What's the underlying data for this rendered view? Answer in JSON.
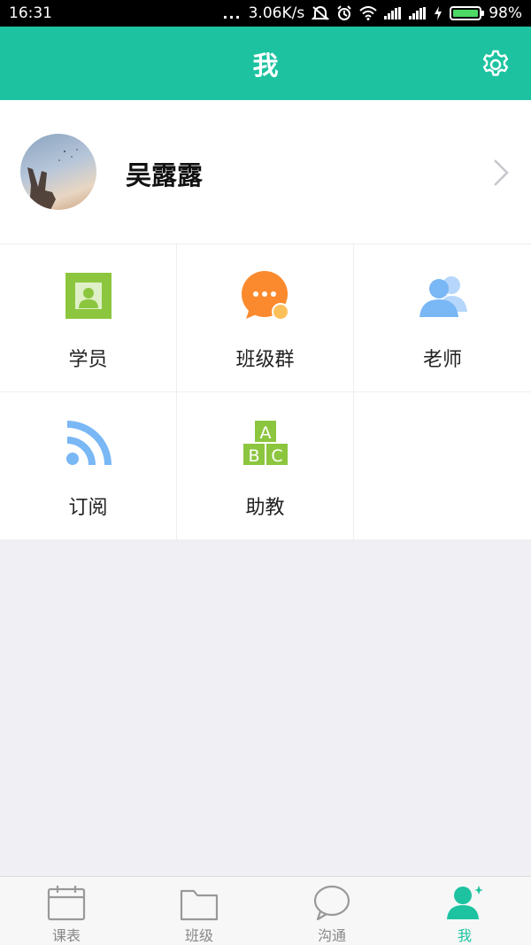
{
  "status_bar": {
    "time": "16:31",
    "dots": "...",
    "network_speed": "3.06K/s",
    "battery_percent": "98%",
    "icons": [
      "mute-icon",
      "alarm-icon",
      "wifi-icon",
      "signal-icon",
      "signal-icon",
      "charging-icon",
      "battery-icon"
    ]
  },
  "header": {
    "title": "我",
    "settings_icon": "gear-icon",
    "accent_color": "#1dc3a0"
  },
  "profile": {
    "name": "吴露露",
    "chevron_icon": "chevron-right-icon"
  },
  "grid": {
    "items": [
      {
        "label": "学员",
        "icon": "student-card-icon",
        "color": "#8cc63f"
      },
      {
        "label": "班级群",
        "icon": "chat-bubble-icon",
        "color": "#fb8a2e"
      },
      {
        "label": "老师",
        "icon": "teachers-icon",
        "color": "#79b7f5"
      },
      {
        "label": "订阅",
        "icon": "rss-icon",
        "color": "#79b7f5"
      },
      {
        "label": "助教",
        "icon": "abc-blocks-icon",
        "color": "#8cc63f"
      }
    ]
  },
  "tab_bar": {
    "active_color": "#1dc3a0",
    "tabs": [
      {
        "label": "课表",
        "icon": "calendar-icon",
        "active": false
      },
      {
        "label": "班级",
        "icon": "folder-icon",
        "active": false
      },
      {
        "label": "沟通",
        "icon": "chat-icon",
        "active": false
      },
      {
        "label": "我",
        "icon": "person-icon",
        "active": true
      }
    ]
  }
}
